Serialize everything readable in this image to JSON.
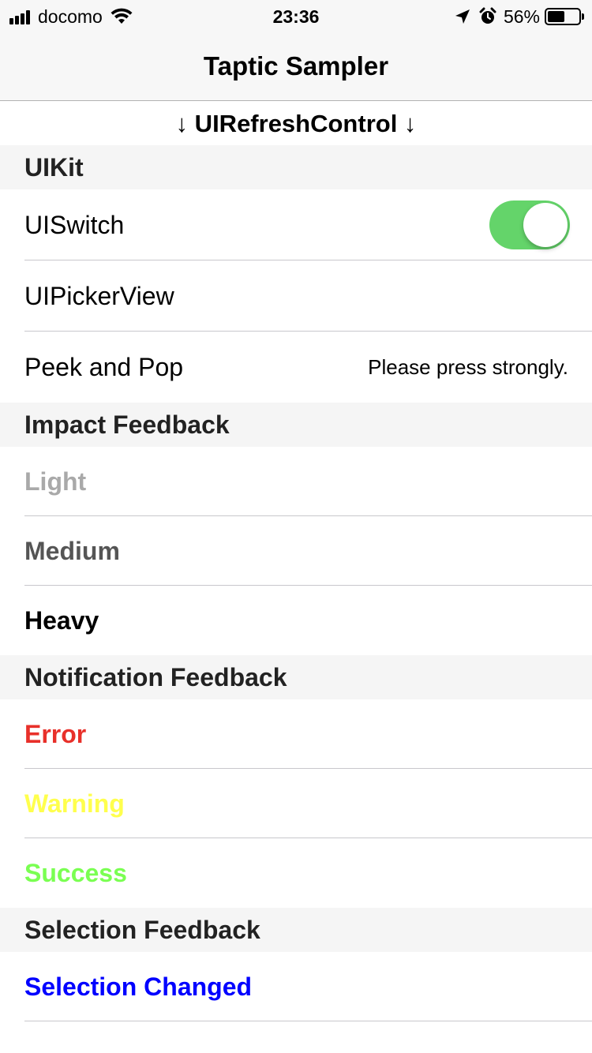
{
  "status_bar": {
    "carrier": "docomo",
    "time": "23:36",
    "battery_percent_text": "56%",
    "battery_level": 0.56,
    "icons": [
      "signal-bars-icon",
      "wifi-icon",
      "location-arrow-icon",
      "alarm-clock-icon",
      "battery-icon"
    ]
  },
  "nav": {
    "title": "Taptic Sampler"
  },
  "refresh_label": "↓ UIRefreshControl ↓",
  "sections": {
    "uikit": {
      "header": "UIKit",
      "switch_label": "UISwitch",
      "switch_on": true,
      "picker_label": "UIPickerView",
      "peek_label": "Peek and Pop",
      "peek_detail": "Please press strongly."
    },
    "impact": {
      "header": "Impact Feedback",
      "light": "Light",
      "medium": "Medium",
      "heavy": "Heavy"
    },
    "notification": {
      "header": "Notification Feedback",
      "error": "Error",
      "warning": "Warning",
      "success": "Success"
    },
    "selection": {
      "header": "Selection Feedback",
      "changed": "Selection Changed"
    }
  },
  "colors": {
    "switch_on": "#64d46a",
    "light": "#a9a9a9",
    "medium": "#555555",
    "heavy": "#000000",
    "error": "#e8302a",
    "warning": "#ffff4d",
    "success": "#7aff52",
    "selection": "#0000ff"
  }
}
